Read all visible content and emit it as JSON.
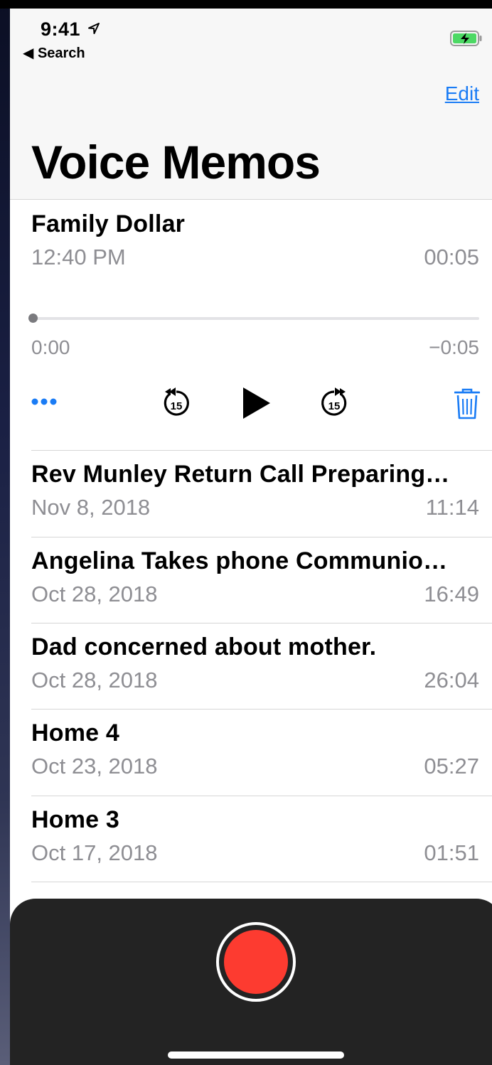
{
  "status_bar": {
    "time": "9:41",
    "back_label": "◀ Search"
  },
  "header": {
    "edit_label": "Edit",
    "title": "Voice Memos"
  },
  "expanded_memo": {
    "name": "Family Dollar",
    "date": "12:40 PM",
    "duration": "00:05",
    "position": "0:00",
    "remaining": "−0:05",
    "progress": 0.0,
    "skip_seconds": "15"
  },
  "memos": [
    {
      "name": "Rev Munley Return Call Preparing…",
      "date": "Nov 8, 2018",
      "duration": "11:14"
    },
    {
      "name": "Angelina Takes phone Communio…",
      "date": "Oct 28, 2018",
      "duration": "16:49"
    },
    {
      "name": "Dad concerned about mother.",
      "date": "Oct 28, 2018",
      "duration": "26:04"
    },
    {
      "name": "Home 4",
      "date": "Oct 23, 2018",
      "duration": "05:27"
    },
    {
      "name": "Home 3",
      "date": "Oct 17, 2018",
      "duration": "01:51"
    }
  ],
  "colors": {
    "accent": "#1a7cf5",
    "record": "#fd3b30",
    "secondary_text": "#8e8e93",
    "battery_fill": "#4cd964"
  }
}
